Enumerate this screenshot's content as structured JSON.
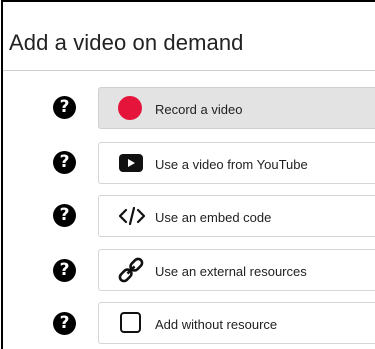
{
  "dialog": {
    "title": "Add a video on demand"
  },
  "help_glyph": "?",
  "options": [
    {
      "label": "Record a video",
      "icon": "record-dot-icon",
      "active": true,
      "color": "#e4143b"
    },
    {
      "label": "Use a video from YouTube",
      "icon": "youtube-play-icon",
      "active": false
    },
    {
      "label": "Use an embed code",
      "icon": "code-brackets-icon",
      "active": false
    },
    {
      "label": "Use an external resources",
      "icon": "link-icon",
      "active": false
    },
    {
      "label": "Add without resource",
      "icon": "empty-square-icon",
      "active": false
    }
  ]
}
